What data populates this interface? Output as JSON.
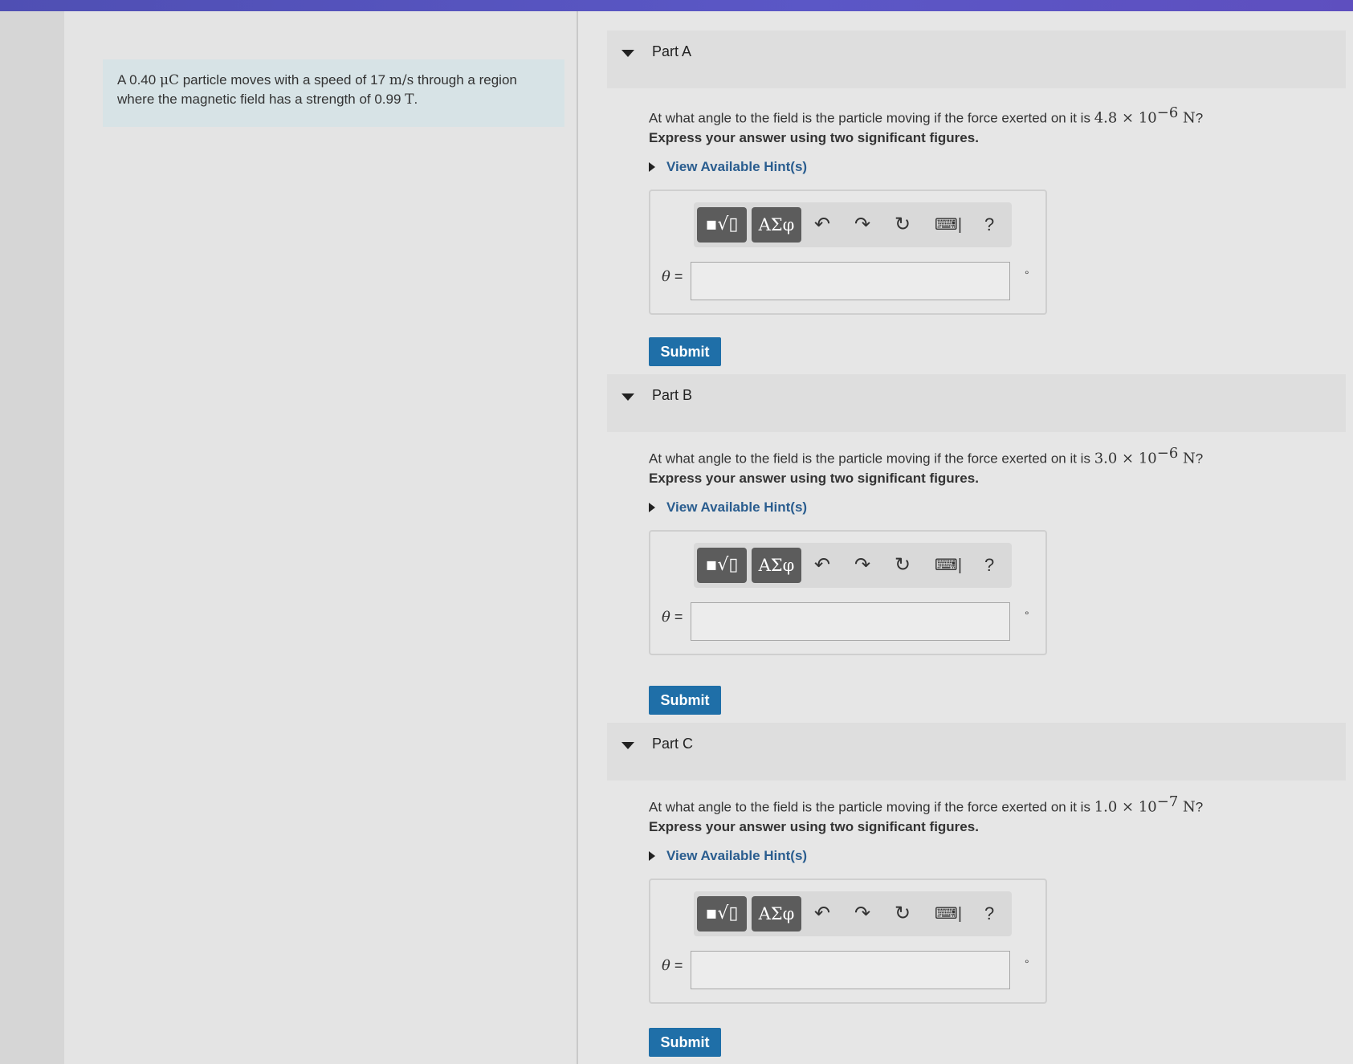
{
  "problem": {
    "text_before_charge": "A 0.40 ",
    "charge_unit": "μC",
    "text_before_speed": " particle moves with a speed of 17 ",
    "speed_unit": "m/s",
    "text_after_speed": " through a region",
    "line2_text": "where the magnetic field has a strength of 0.99 ",
    "field_unit": "T",
    "line2_end": "."
  },
  "toolbar": {
    "template_icon": "template-sqrt-icon",
    "template_glyph": "▪√▯",
    "symbols_label": "ΑΣφ",
    "undo_glyph": "↶",
    "redo_glyph": "↷",
    "reset_glyph": "↻",
    "keyboard_glyph": "⌨|",
    "help_glyph": "?"
  },
  "parts": [
    {
      "title": "Part A",
      "question_prefix": "At what angle to the field is the particle moving if the force exerted on it is ",
      "force_mantissa": "4.8",
      "force_times": " × 10",
      "force_exponent": "−6",
      "force_unit": " N",
      "question_suffix": "?",
      "instruction": "Express your answer using two significant figures.",
      "hint": "View Available Hint(s)",
      "variable": "θ",
      "equals": " =",
      "input_value": "",
      "unit": "°",
      "submit": "Submit"
    },
    {
      "title": "Part B",
      "question_prefix": "At what angle to the field is the particle moving if the force exerted on it is ",
      "force_mantissa": "3.0",
      "force_times": " × 10",
      "force_exponent": "−6",
      "force_unit": " N",
      "question_suffix": "?",
      "instruction": "Express your answer using two significant figures.",
      "hint": "View Available Hint(s)",
      "variable": "θ",
      "equals": " =",
      "input_value": "",
      "unit": "°",
      "submit": "Submit"
    },
    {
      "title": "Part C",
      "question_prefix": "At what angle to the field is the particle moving if the force exerted on it is ",
      "force_mantissa": "1.0",
      "force_times": " × 10",
      "force_exponent": "−7",
      "force_unit": " N",
      "question_suffix": "?",
      "instruction": "Express your answer using two significant figures.",
      "hint": "View Available Hint(s)",
      "variable": "θ",
      "equals": " =",
      "input_value": "",
      "unit": "°",
      "submit": "Submit"
    }
  ]
}
